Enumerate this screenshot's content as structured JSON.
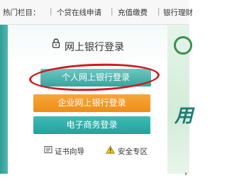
{
  "topbar": {
    "label": "热门栏目：",
    "items": [
      "个贷在线申请",
      "充值缴费",
      "银行理财"
    ],
    "separator": "|"
  },
  "login": {
    "title": "网上银行登录",
    "personal_button": "个人网上银行登录",
    "corporate_button": "企业网上银行登录",
    "ecommerce_button": "电子商务登录",
    "cert_guide": "证书向导",
    "security_zone": "安全专区"
  },
  "right_panel": {
    "big_char": "用",
    "arrow": "›"
  },
  "colors": {
    "teal": "#3aa49f",
    "orange": "#ee8e16",
    "highlight": "#d11a1f"
  },
  "icons": [
    "lock-icon",
    "certificate-icon",
    "warning-icon"
  ]
}
